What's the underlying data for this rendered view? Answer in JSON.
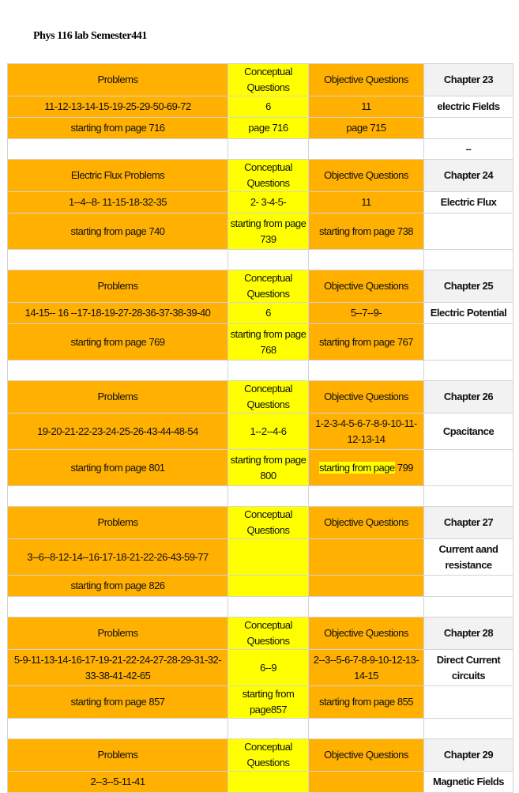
{
  "document": {
    "title": "Phys 116 lab   Semester441"
  },
  "dash": "–",
  "chapters": [
    {
      "problems_header": "Problems",
      "conceptual_header": "Conceptual Questions",
      "objective_header": "Objective Questions",
      "chapter_label": "Chapter 23",
      "problems": "11-12-13-14-15-19-25-29-50-69-72",
      "conceptual": "6",
      "objective": "11",
      "chapter_name": "electric Fields",
      "problems_page": "starting from page 716",
      "conceptual_page": "page 716",
      "objective_page": "page 715"
    },
    {
      "problems_header": "Electric Flux Problems",
      "conceptual_header": "Conceptual Questions",
      "objective_header": "Objective Questions",
      "chapter_label": "Chapter 24",
      "problems": "1--4--8- 11-15-18-32-35",
      "conceptual": "2- 3-4-5-",
      "objective": "11",
      "chapter_name": "Electric Flux",
      "problems_page": "starting from page 740",
      "conceptual_page": "starting from page 739",
      "objective_page": "starting from page 738"
    },
    {
      "problems_header": "Problems",
      "conceptual_header": "Conceptual Questions",
      "objective_header": "Objective Questions",
      "chapter_label": "Chapter 25",
      "problems": "14-15-- 16 --17-18-19-27-28-36-37-38-39-40",
      "conceptual": "6",
      "objective": "5--7--9-",
      "chapter_name": "Electric Potential",
      "problems_page": "starting from page  769",
      "conceptual_page": "starting from page  768",
      "objective_page": "starting from page 767"
    },
    {
      "problems_header": "Problems",
      "conceptual_header": "Conceptual Questions",
      "objective_header": "Objective Questions",
      "chapter_label": "Chapter 26",
      "problems": "19-20-21-22-23-24-25-26-43-44-48-54",
      "conceptual": "1--2--4-6",
      "objective": "1-2-3-4-5-6-7-8-9-10-11-12-13-14",
      "chapter_name": "Cpacitance",
      "problems_page": "starting from page  801",
      "conceptual_page": "starting from page  800",
      "objective_page_highlight": "starting from page",
      "objective_page_rest": " 799"
    },
    {
      "problems_header": "Problems",
      "conceptual_header": "Conceptual Questions",
      "objective_header": "Objective Questions",
      "chapter_label": "Chapter 27",
      "problems": "3--6--8-12-14--16-17-18-21-22-26-43-59-77",
      "conceptual": "",
      "objective": "",
      "chapter_name": "Current aand resistance",
      "problems_page": "starting from page  826"
    },
    {
      "problems_header": "Problems",
      "conceptual_header": "Conceptual Questions",
      "objective_header": "Objective Questions",
      "chapter_label": "Chapter 28",
      "problems": "5-9-11-13-14-16-17-19-21-22-24-27-28-29-31-32-33-38-41-42-65",
      "conceptual": "6--9",
      "objective": "2--3--5-6-7-8-9-10-12-13-14-15",
      "chapter_name": "Direct Current circuits",
      "problems_page": "starting from page  857",
      "conceptual_page": "starting from page857",
      "objective_page": "starting from page 855"
    },
    {
      "problems_header": "Problems",
      "conceptual_header": "Conceptual Questions",
      "objective_header": "Objective Questions",
      "chapter_label": "Chapter 29",
      "problems": "2--3--5-11-41",
      "conceptual": "",
      "objective": "",
      "chapter_name": "Magnetic Fields"
    }
  ]
}
